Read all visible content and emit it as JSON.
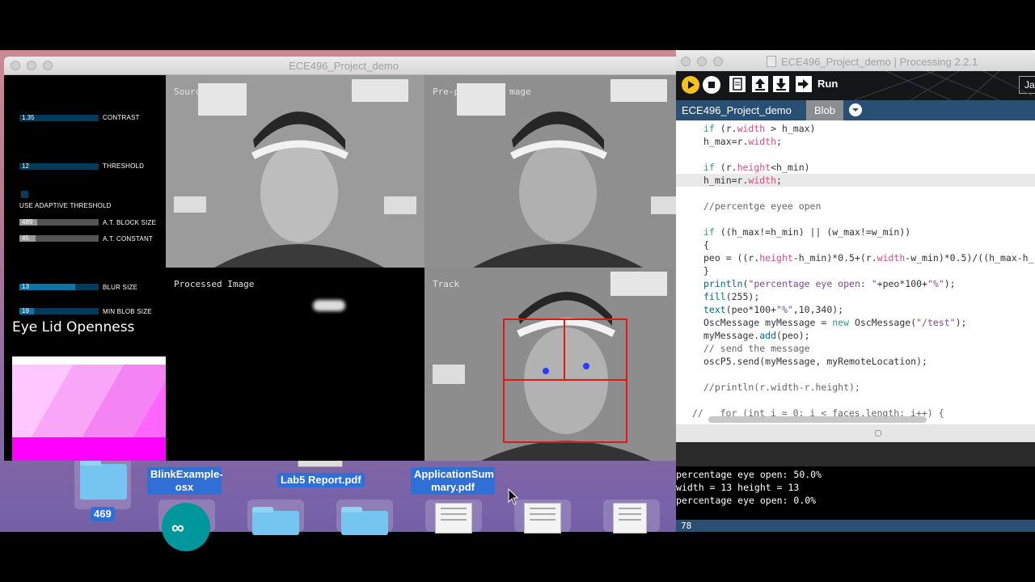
{
  "desktop": {
    "icons": [
      {
        "label": "469",
        "kind": "folder"
      },
      {
        "label": "BlinkExample-osx",
        "kind": "app"
      },
      {
        "label": "Lab5 Report.pdf",
        "kind": "pdf"
      },
      {
        "label": "ApplicationSummary.pdf",
        "kind": "pdf"
      }
    ],
    "label_469": "469",
    "label_blink_1": "BlinkExample-",
    "label_blink_2": "osx",
    "label_lab5": "Lab5 Report.pdf",
    "label_app_1": "ApplicationSum",
    "label_app_2": "mary.pdf"
  },
  "app_window": {
    "title": "ECE496_Project_demo",
    "controls": [
      {
        "label": "CONTRAST",
        "value": "1.35",
        "fraction": 0.0
      },
      {
        "label": "THRESHOLD",
        "value": "12",
        "fraction": 0.0
      },
      {
        "label": "USE ADAPTIVE THRESHOLD"
      },
      {
        "label": "A.T. BLOCK SIZE",
        "value": "489",
        "fraction": 0.22
      },
      {
        "label": "A.T. CONSTANT",
        "value": "45",
        "fraction": 0.2
      },
      {
        "label": "BLUR SIZE",
        "value": "13",
        "fraction": 0.7
      },
      {
        "label": "MIN BLOB SIZE",
        "value": "19",
        "fraction": 0.18
      }
    ],
    "eye_lid_title": "Eye Lid Openness",
    "eye_lid_openness": 0.0,
    "panels": {
      "source": "Source",
      "preprocessed": "Pre-p",
      "preprocessed_tail": "mage",
      "processed": "Processed Image",
      "tracked": "Track"
    }
  },
  "ide": {
    "title": "ECE496_Project_demo | Processing 2.2.1",
    "run_label": "Run",
    "mode_label": "Ja",
    "tabs": [
      {
        "label": "ECE496_Project_demo",
        "active": false
      },
      {
        "label": "Blob",
        "active": true
      }
    ],
    "console_lines": [
      "percentage eye open: 50.0%",
      "width = 13 height = 13",
      "percentage eye open: 0.0%"
    ],
    "line_number": "78",
    "colors": {
      "toolbar": "#14161a",
      "run_button": "#f5c21b",
      "tab_active": "#8a8d91",
      "tab_bar": "#2a4f74"
    }
  }
}
